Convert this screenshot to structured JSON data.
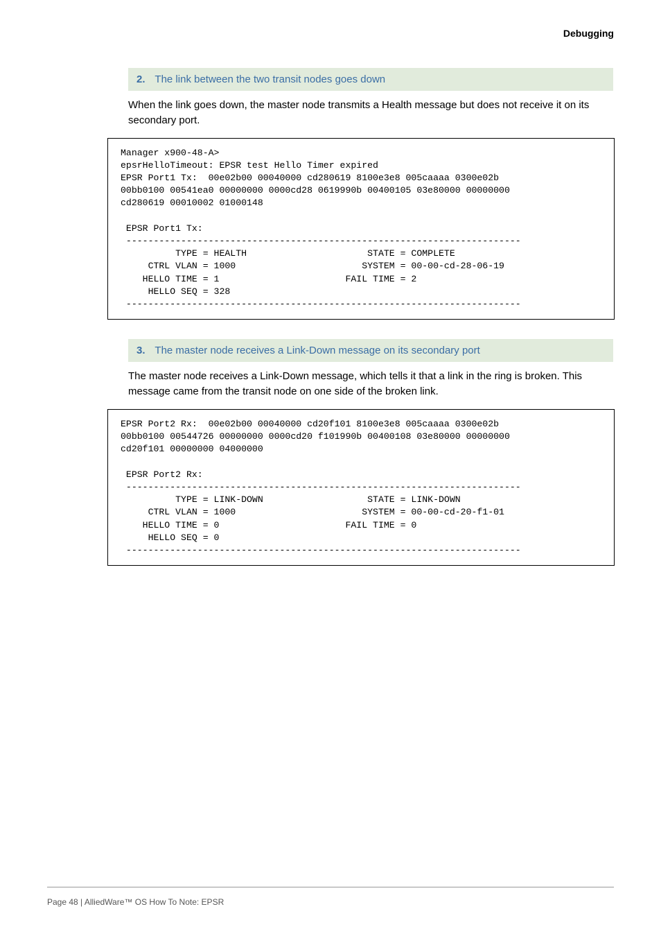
{
  "header": {
    "section": "Debugging"
  },
  "steps": [
    {
      "number": "2.",
      "title": "The link between the two transit nodes goes down",
      "body": "When the link goes down, the master node transmits a Health message but does not receive it on its secondary port.",
      "code": "Manager x900-48-A>\nepsrHelloTimeout: EPSR test Hello Timer expired\nEPSR Port1 Tx:  00e02b00 00040000 cd280619 8100e3e8 005caaaa 0300e02b \n00bb0100 00541ea0 00000000 0000cd28 0619990b 00400105 03e80000 00000000 \ncd280619 00010002 01000148 \n\n EPSR Port1 Tx:\n ------------------------------------------------------------------------\n          TYPE = HEALTH                      STATE = COMPLETE\n     CTRL VLAN = 1000                       SYSTEM = 00-00-cd-28-06-19\n    HELLO TIME = 1                       FAIL TIME = 2\n     HELLO SEQ = 328\n ------------------------------------------------------------------------"
    },
    {
      "number": "3.",
      "title": "The master node receives a Link-Down message on its secondary port",
      "body": "The master node receives a Link-Down message, which tells it that a link in the ring is broken. This message came from the transit node on one side of the broken link.",
      "code": "EPSR Port2 Rx:  00e02b00 00040000 cd20f101 8100e3e8 005caaaa 0300e02b \n00bb0100 00544726 00000000 0000cd20 f101990b 00400108 03e80000 00000000 \ncd20f101 00000000 04000000 \n\n EPSR Port2 Rx:\n ------------------------------------------------------------------------\n          TYPE = LINK-DOWN                   STATE = LINK-DOWN\n     CTRL VLAN = 1000                       SYSTEM = 00-00-cd-20-f1-01\n    HELLO TIME = 0                       FAIL TIME = 0\n     HELLO SEQ = 0\n ------------------------------------------------------------------------"
    }
  ],
  "footer": {
    "text": "Page 48 | AlliedWare™ OS How To Note: EPSR"
  }
}
